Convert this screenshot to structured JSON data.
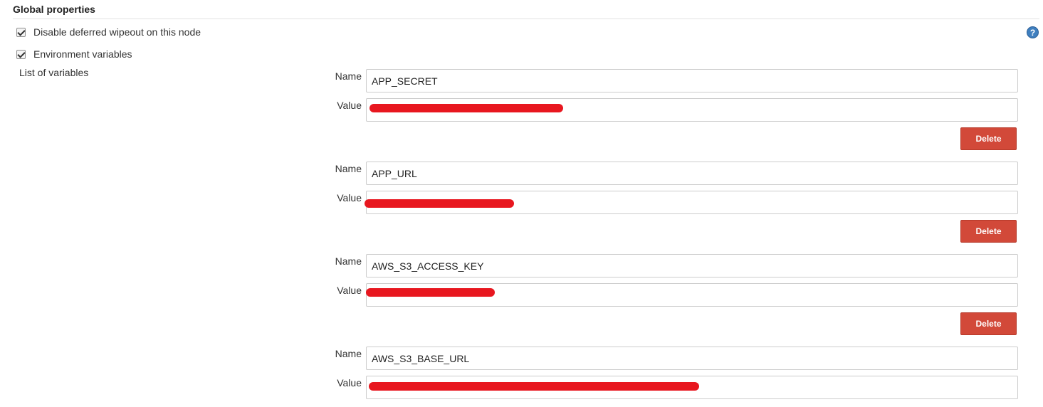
{
  "section": {
    "title": "Global properties"
  },
  "options": {
    "disable_wipeout_label": "Disable deferred wipeout on this node",
    "disable_wipeout_checked": true,
    "env_vars_label": "Environment variables",
    "env_vars_checked": true
  },
  "help": {
    "icon": "help-icon",
    "glyph": "?"
  },
  "variables": {
    "list_label": "List of variables",
    "name_label": "Name",
    "value_label": "Value",
    "delete_label": "Delete",
    "items": [
      {
        "name": "APP_SECRET",
        "value": "",
        "value_redacted": true
      },
      {
        "name": "APP_URL",
        "value": "",
        "value_redacted": true
      },
      {
        "name": "AWS_S3_ACCESS_KEY",
        "value": "",
        "value_redacted": true
      },
      {
        "name": "AWS_S3_BASE_URL",
        "value": "",
        "value_redacted": true
      }
    ]
  },
  "colors": {
    "delete_button": "#d24939",
    "redaction": "#e8171f",
    "help_icon": "#3f7fbf"
  }
}
